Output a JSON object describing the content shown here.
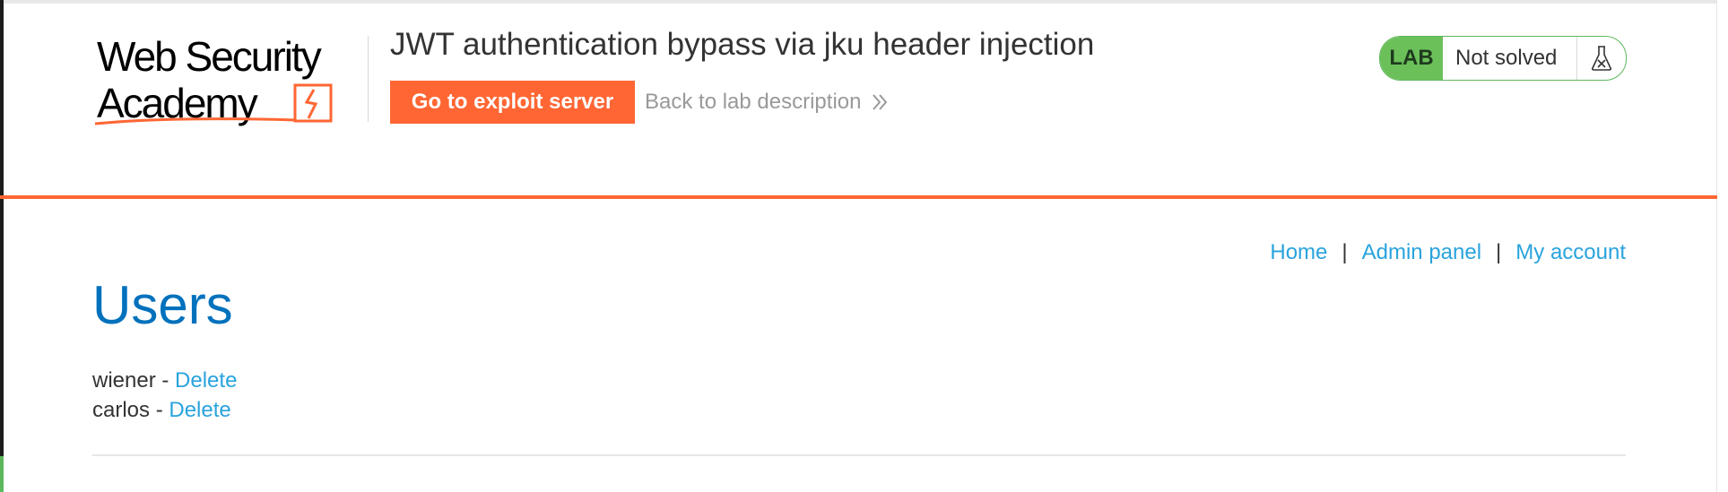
{
  "logo": {
    "line1": "Web Security",
    "line2": "Academy"
  },
  "lab": {
    "title": "JWT authentication bypass via jku header injection",
    "exploit_button": "Go to exploit server",
    "back_link": "Back to lab description",
    "status_badge": "LAB",
    "status_text": "Not solved"
  },
  "nav": {
    "home": "Home",
    "admin": "Admin panel",
    "account": "My account",
    "separator": "|"
  },
  "page": {
    "title": "Users"
  },
  "users": [
    {
      "name": "wiener",
      "dash": "-",
      "action": "Delete"
    },
    {
      "name": "carlos",
      "dash": "-",
      "action": "Delete"
    }
  ],
  "colors": {
    "accent": "#ff6633",
    "link": "#29a3dd",
    "title": "#0071bc",
    "solved_green": "#6cc05a"
  }
}
